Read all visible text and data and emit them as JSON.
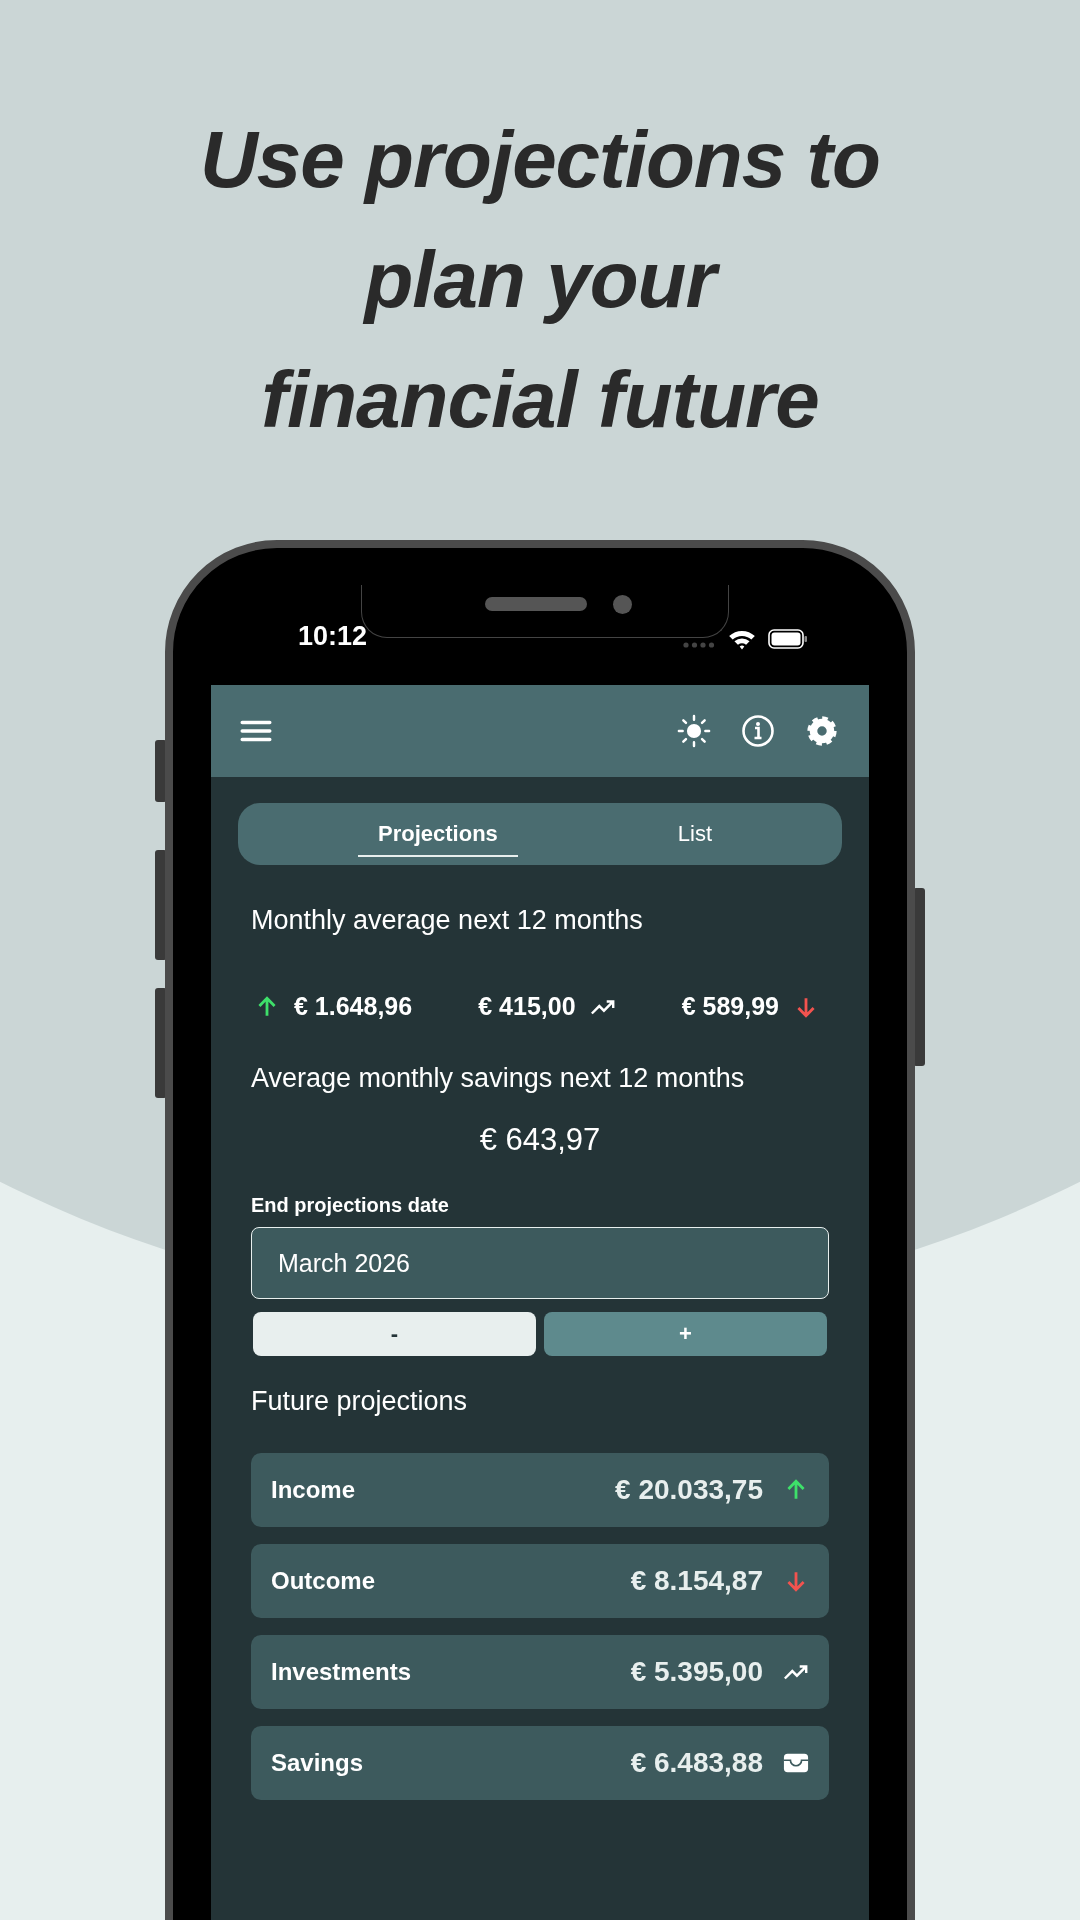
{
  "headline": [
    "Use projections to",
    "plan your",
    "financial future"
  ],
  "status_bar": {
    "time": "10:12"
  },
  "tabs": [
    {
      "label": "Projections",
      "selected": true
    },
    {
      "label": "List",
      "selected": false
    }
  ],
  "monthly_average": {
    "title": "Monthly average next 12 months",
    "stats": [
      {
        "kind": "income",
        "amount": "€ 1.648,96"
      },
      {
        "kind": "investment",
        "amount": "€ 415,00"
      },
      {
        "kind": "outcome",
        "amount": "€ 589,99"
      }
    ]
  },
  "savings": {
    "title": "Average monthly savings next 12 months",
    "amount": "€ 643,97"
  },
  "end_date": {
    "label": "End projections date",
    "value": "March 2026",
    "buttons": [
      "-",
      "+"
    ]
  },
  "future": {
    "title": "Future projections",
    "cards": [
      {
        "kind": "income",
        "label": "Income",
        "amount": "€ 20.033,75"
      },
      {
        "kind": "outcome",
        "label": "Outcome",
        "amount": "€ 8.154,87"
      },
      {
        "kind": "investment",
        "label": "Investments",
        "amount": "€ 5.395,00"
      },
      {
        "kind": "savings",
        "label": "Savings",
        "amount": "€ 6.483,88"
      }
    ]
  }
}
